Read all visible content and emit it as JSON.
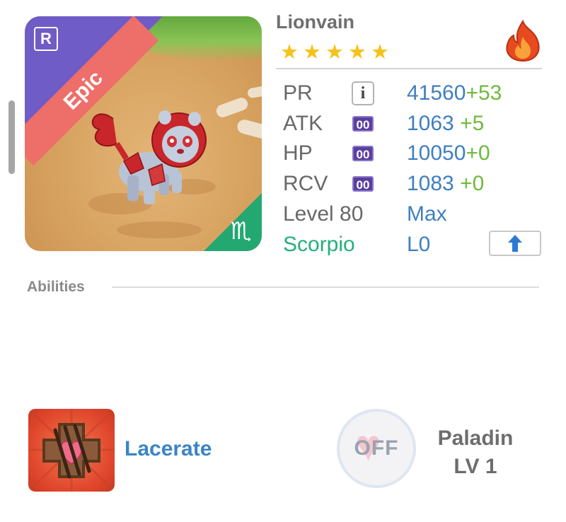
{
  "monster": {
    "name": "Lionvain",
    "rarity_letter": "R",
    "rarity_label": "Epic",
    "stars": 5,
    "element": "fire-icon",
    "zodiac_glyph": "♏"
  },
  "stats": [
    {
      "label": "PR",
      "badge": "i",
      "base": "41560",
      "bonus": "+53"
    },
    {
      "label": "ATK",
      "badge": "00",
      "base": "1063",
      "bonus": "+5"
    },
    {
      "label": "HP",
      "badge": "00",
      "base": "10050",
      "bonus": "+0"
    },
    {
      "label": "RCV",
      "badge": "00",
      "base": "1083",
      "bonus": "+0"
    }
  ],
  "level": {
    "label": "Level 80",
    "value": "Max"
  },
  "zodiac": {
    "label": "Scorpio",
    "value": "L0"
  },
  "abilities": {
    "title": "Abilities",
    "skill_name": "Lacerate",
    "leader_status": "OFF",
    "leader_name": "Paladin",
    "leader_level": "LV 1"
  },
  "colors": {
    "accent_blue": "#3f7fc0",
    "bonus_green": "#6dbb3c",
    "zodiac_green": "#23b07b",
    "epic_purple": "#6f5cc6",
    "epic_ribbon": "#ee6e6a",
    "star_gold": "#f4c21a"
  }
}
